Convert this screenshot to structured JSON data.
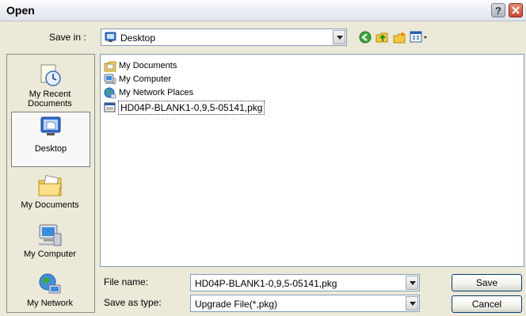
{
  "window": {
    "title": "Open"
  },
  "toolbar": {
    "save_in_label": "Save in :",
    "save_in_value": "Desktop"
  },
  "places": [
    {
      "label": "My Recent Documents",
      "selected": false,
      "icon": "recent-documents-icon"
    },
    {
      "label": "Desktop",
      "selected": true,
      "icon": "desktop-icon"
    },
    {
      "label": "My Documents",
      "selected": false,
      "icon": "my-documents-icon"
    },
    {
      "label": "My Computer",
      "selected": false,
      "icon": "my-computer-icon"
    },
    {
      "label": "My Network",
      "selected": false,
      "icon": "network-icon"
    }
  ],
  "files": [
    {
      "name": "My Documents",
      "icon": "folder-documents-icon"
    },
    {
      "name": "My Computer",
      "icon": "computer-icon"
    },
    {
      "name": "My Network Places",
      "icon": "network-places-icon"
    },
    {
      "name": "HD04P-BLANK1-0,9,5-05141,pkg",
      "icon": "package-file-icon",
      "selected": true
    }
  ],
  "form": {
    "file_name_label": "File name:",
    "file_name_value": "HD04P-BLANK1-0,9,5-05141,pkg",
    "save_as_type_label": "Save as type:",
    "save_as_type_value": "Upgrade File(*,pkg)"
  },
  "buttons": {
    "save": "Save",
    "cancel": "Cancel"
  }
}
